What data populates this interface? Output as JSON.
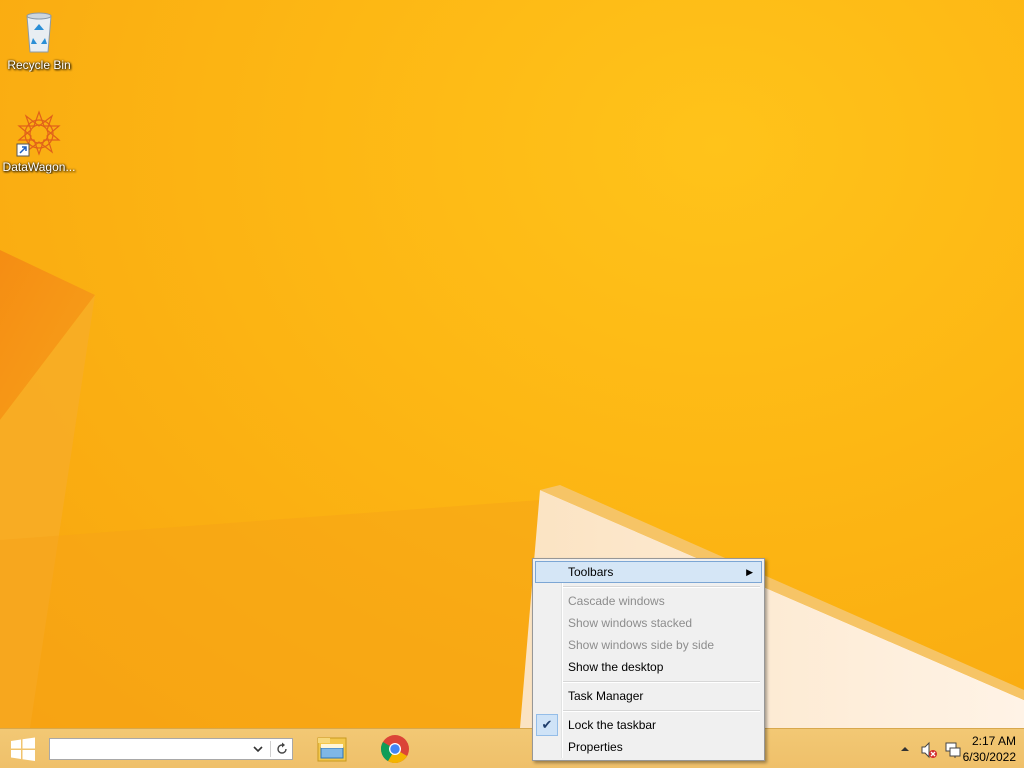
{
  "desktop": {
    "icons": [
      {
        "label": "Recycle Bin",
        "icon": "recycle-bin-icon"
      },
      {
        "label": "DataWagon...",
        "icon": "datawagon-app-icon"
      }
    ]
  },
  "taskbar": {
    "start_icon": "windows-start-icon",
    "address_value": "",
    "pinned": [
      {
        "name": "File Explorer",
        "icon": "file-explorer-icon"
      },
      {
        "name": "Google Chrome",
        "icon": "chrome-icon"
      }
    ],
    "tray": {
      "overflow_icon": "tray-overflow-up-icon",
      "volume_icon": "volume-muted-icon",
      "network_icon": "network-icon"
    },
    "clock": {
      "time": "2:17 AM",
      "date": "6/30/2022"
    }
  },
  "context_menu": {
    "items": [
      {
        "label": "Toolbars",
        "state": "highlighted",
        "submenu": true
      },
      {
        "label": "Cascade windows",
        "state": "disabled"
      },
      {
        "label": "Show windows stacked",
        "state": "disabled"
      },
      {
        "label": "Show windows side by side",
        "state": "disabled"
      },
      {
        "label": "Show the desktop",
        "state": "enabled"
      },
      {
        "label": "Task Manager",
        "state": "enabled"
      },
      {
        "label": "Lock the taskbar",
        "state": "checked"
      },
      {
        "label": "Properties",
        "state": "enabled"
      }
    ],
    "check_glyph": "✔",
    "submenu_glyph": "▶"
  },
  "colors": {
    "wallpaper": "#fdb714",
    "taskbar": "#f0c36e",
    "menu_highlight": "#d5e6f6"
  }
}
